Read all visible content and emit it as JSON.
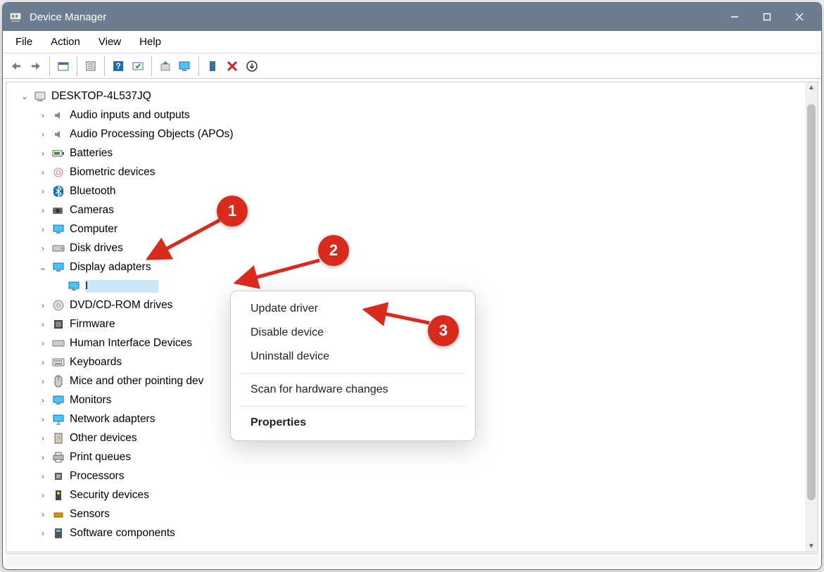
{
  "window": {
    "title": "Device Manager"
  },
  "menubar": [
    "File",
    "Action",
    "View",
    "Help"
  ],
  "tree": {
    "root": "DESKTOP-4L537JQ",
    "children": [
      {
        "label": "Audio inputs and outputs",
        "icon": "speaker"
      },
      {
        "label": "Audio Processing Objects (APOs)",
        "icon": "speaker"
      },
      {
        "label": "Batteries",
        "icon": "battery"
      },
      {
        "label": "Biometric devices",
        "icon": "fingerprint"
      },
      {
        "label": "Bluetooth",
        "icon": "bluetooth"
      },
      {
        "label": "Cameras",
        "icon": "camera"
      },
      {
        "label": "Computer",
        "icon": "computer"
      },
      {
        "label": "Disk drives",
        "icon": "disk"
      },
      {
        "label": "Display adapters",
        "icon": "display",
        "expanded": true,
        "children": [
          {
            "label": "I",
            "icon": "display-device",
            "selected": true
          }
        ]
      },
      {
        "label": "DVD/CD-ROM drives",
        "icon": "dvd"
      },
      {
        "label": "Firmware",
        "icon": "firmware"
      },
      {
        "label": "Human Interface Devices",
        "icon": "hid"
      },
      {
        "label": "Keyboards",
        "icon": "keyboard"
      },
      {
        "label": "Mice and other pointing dev",
        "icon": "mouse"
      },
      {
        "label": "Monitors",
        "icon": "monitor"
      },
      {
        "label": "Network adapters",
        "icon": "network"
      },
      {
        "label": "Other devices",
        "icon": "other"
      },
      {
        "label": "Print queues",
        "icon": "printer"
      },
      {
        "label": "Processors",
        "icon": "cpu"
      },
      {
        "label": "Security devices",
        "icon": "security"
      },
      {
        "label": "Sensors",
        "icon": "sensor"
      },
      {
        "label": "Software components",
        "icon": "software"
      }
    ]
  },
  "context_menu": {
    "items": [
      {
        "label": "Update driver"
      },
      {
        "label": "Disable device"
      },
      {
        "label": "Uninstall device"
      },
      {
        "sep": true
      },
      {
        "label": "Scan for hardware changes"
      },
      {
        "sep": true
      },
      {
        "label": "Properties",
        "bold": true
      }
    ]
  },
  "annotations": {
    "b1": "1",
    "b2": "2",
    "b3": "3"
  }
}
